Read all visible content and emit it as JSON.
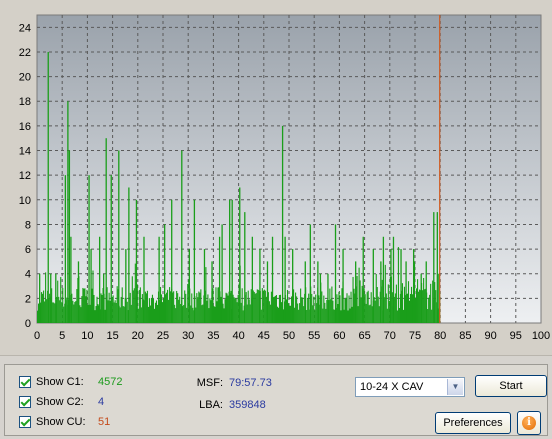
{
  "chart_data": {
    "type": "bar",
    "title": "",
    "xlabel": "",
    "ylabel": "",
    "xlim": [
      0,
      100
    ],
    "ylim": [
      0,
      25
    ],
    "x_ticks": [
      0,
      5,
      10,
      15,
      20,
      25,
      30,
      35,
      40,
      45,
      50,
      55,
      60,
      65,
      70,
      75,
      80,
      85,
      90,
      95,
      100
    ],
    "y_ticks": [
      0,
      2,
      4,
      6,
      8,
      10,
      12,
      14,
      16,
      18,
      20,
      22,
      24
    ],
    "grid": true,
    "series": [
      {
        "values_x_start": 0,
        "values_x_end": 80,
        "color": "#1a9e1a",
        "baseline_range": [
          1,
          3
        ],
        "spikes": [
          {
            "x": 0.4,
            "y": 4
          },
          {
            "x": 2.1,
            "y": 22
          },
          {
            "x": 2.6,
            "y": 4
          },
          {
            "x": 3.6,
            "y": 4
          },
          {
            "x": 5.5,
            "y": 12
          },
          {
            "x": 6.0,
            "y": 18
          },
          {
            "x": 6.3,
            "y": 14
          },
          {
            "x": 6.6,
            "y": 7
          },
          {
            "x": 8.1,
            "y": 5
          },
          {
            "x": 10.2,
            "y": 12
          },
          {
            "x": 10.6,
            "y": 6
          },
          {
            "x": 12.3,
            "y": 7
          },
          {
            "x": 13.1,
            "y": 4
          },
          {
            "x": 13.6,
            "y": 15
          },
          {
            "x": 14.6,
            "y": 12
          },
          {
            "x": 16.1,
            "y": 14
          },
          {
            "x": 17.5,
            "y": 6
          },
          {
            "x": 18.1,
            "y": 11
          },
          {
            "x": 19.6,
            "y": 10
          },
          {
            "x": 21.1,
            "y": 7
          },
          {
            "x": 24.1,
            "y": 7
          },
          {
            "x": 25.2,
            "y": 8
          },
          {
            "x": 26.6,
            "y": 10
          },
          {
            "x": 28.6,
            "y": 14
          },
          {
            "x": 30.1,
            "y": 6
          },
          {
            "x": 31.1,
            "y": 10
          },
          {
            "x": 33.1,
            "y": 6
          },
          {
            "x": 34.6,
            "y": 5
          },
          {
            "x": 36.1,
            "y": 7
          },
          {
            "x": 36.6,
            "y": 8
          },
          {
            "x": 38.1,
            "y": 10
          },
          {
            "x": 38.6,
            "y": 10
          },
          {
            "x": 40.1,
            "y": 11
          },
          {
            "x": 41.1,
            "y": 9
          },
          {
            "x": 42.6,
            "y": 7
          },
          {
            "x": 44.1,
            "y": 6
          },
          {
            "x": 45.6,
            "y": 5
          },
          {
            "x": 46.6,
            "y": 7
          },
          {
            "x": 48.6,
            "y": 16
          },
          {
            "x": 49.1,
            "y": 7
          },
          {
            "x": 50.6,
            "y": 6
          },
          {
            "x": 53.1,
            "y": 5
          },
          {
            "x": 54.1,
            "y": 8
          },
          {
            "x": 55.6,
            "y": 5
          },
          {
            "x": 56.1,
            "y": 4
          },
          {
            "x": 57.6,
            "y": 4
          },
          {
            "x": 59.1,
            "y": 8
          },
          {
            "x": 60.6,
            "y": 6
          },
          {
            "x": 63.1,
            "y": 5
          },
          {
            "x": 64.6,
            "y": 7
          },
          {
            "x": 66.6,
            "y": 6
          },
          {
            "x": 68.1,
            "y": 5
          },
          {
            "x": 68.6,
            "y": 7
          },
          {
            "x": 70.1,
            "y": 6
          },
          {
            "x": 70.6,
            "y": 7
          },
          {
            "x": 72.1,
            "y": 6
          },
          {
            "x": 73.1,
            "y": 5
          },
          {
            "x": 74.6,
            "y": 6
          },
          {
            "x": 76.1,
            "y": 4
          },
          {
            "x": 77.1,
            "y": 5
          },
          {
            "x": 78.6,
            "y": 9
          },
          {
            "x": 79.3,
            "y": 9
          },
          {
            "x": 79.6,
            "y": 4
          }
        ]
      }
    ],
    "marker_x": 80,
    "marker_color": "#d05a20",
    "plot_background_top": "#9aa2ab",
    "plot_background_bottom": "#eef0f2"
  },
  "controls": {
    "show_c1": {
      "label": "Show C1:",
      "value": "4572",
      "checked": true
    },
    "show_c2": {
      "label": "Show C2:",
      "value": "4",
      "checked": true
    },
    "show_cu": {
      "label": "Show CU:",
      "value": "51",
      "checked": true
    },
    "msf": {
      "label": "MSF:",
      "value": "79:57.73"
    },
    "lba": {
      "label": "LBA:",
      "value": "359848"
    },
    "speed_select": {
      "value": "10-24 X CAV"
    },
    "start_button": {
      "label": "Start"
    },
    "preferences_button": {
      "label": "Preferences"
    },
    "info_button": {
      "icon": "info-icon",
      "glyph": "i"
    }
  },
  "colors": {
    "c1": "#1c9a1c",
    "c2": "#2a3aa0",
    "cu": "#c44a1a",
    "info_value": "#2a3aa0"
  }
}
